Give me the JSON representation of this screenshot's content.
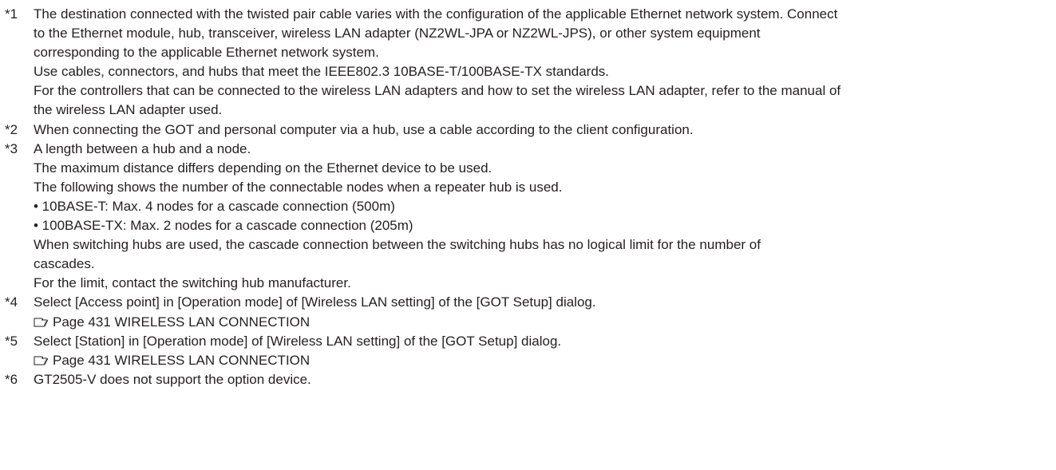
{
  "notes": [
    {
      "mark": "*1",
      "lines": [
        "The destination connected with the twisted pair cable varies with the configuration of the applicable Ethernet network system. Connect",
        "to the Ethernet module, hub, transceiver, wireless LAN adapter (NZ2WL-JPA or NZ2WL-JPS), or other system equipment",
        "corresponding to the applicable Ethernet network system.",
        "Use cables, connectors, and hubs that meet the IEEE802.3 10BASE-T/100BASE-TX standards.",
        "For the controllers that can be connected to the wireless LAN adapters and how to set the wireless LAN adapter, refer to the manual of",
        "the wireless LAN adapter used."
      ]
    },
    {
      "mark": "*2",
      "lines": [
        "When connecting the GOT and personal computer via a hub, use a cable according to the client configuration."
      ]
    },
    {
      "mark": "*3",
      "lines": [
        "A length between a hub and a node.",
        "The maximum distance differs depending on the Ethernet device to be used.",
        "The following shows the number of the connectable nodes when a repeater hub is used.",
        "• 10BASE-T: Max. 4 nodes for a cascade connection (500m)",
        "• 100BASE-TX: Max. 2 nodes for a cascade connection (205m)",
        "When switching hubs are used, the cascade connection between the switching hubs has no logical limit for the number of",
        "cascades.",
        "For the limit, contact the switching hub manufacturer."
      ]
    },
    {
      "mark": "*4",
      "lines": [
        "Select [Access point] in [Operation mode] of [Wireless LAN setting] of the [GOT Setup] dialog."
      ],
      "ref": "Page 431 WIRELESS LAN CONNECTION"
    },
    {
      "mark": "*5",
      "lines": [
        "Select [Station] in [Operation mode] of [Wireless LAN setting] of the [GOT Setup] dialog."
      ],
      "ref": "Page 431 WIRELESS LAN CONNECTION"
    },
    {
      "mark": "*6",
      "lines": [
        "GT2505-V does not support the option device."
      ]
    }
  ],
  "ref_icon": "pointing-hand-icon",
  "colors": {
    "text": "#231f20",
    "background": "#ffffff"
  }
}
